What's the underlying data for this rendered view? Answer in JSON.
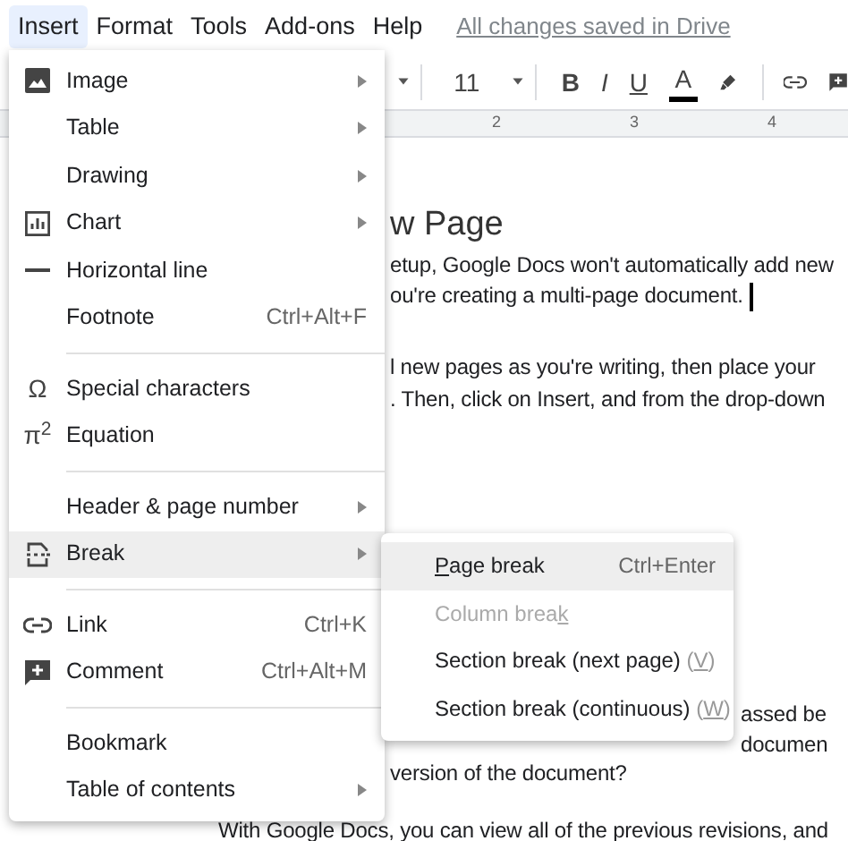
{
  "menubar": {
    "items": [
      {
        "label": "Insert",
        "selected": true
      },
      {
        "label": "Format",
        "selected": false
      },
      {
        "label": "Tools",
        "selected": false
      },
      {
        "label": "Add-ons",
        "selected": false
      },
      {
        "label": "Help",
        "selected": false
      }
    ],
    "save_status": "All changes saved in Drive"
  },
  "toolbar": {
    "font_size": "11",
    "format_buttons": [
      {
        "kind": "bold",
        "label": "B"
      },
      {
        "kind": "italic",
        "label": "I"
      },
      {
        "kind": "underline",
        "label": "U"
      },
      {
        "kind": "text_color",
        "label": "A"
      }
    ]
  },
  "ruler": {
    "numbers": [
      "2",
      "3",
      "4"
    ]
  },
  "document": {
    "blocks": [
      {
        "kind": "heading",
        "lines": [
          {
            "text": "w Page"
          }
        ]
      },
      {
        "kind": "paragraph",
        "lines": [
          {
            "text": "etup, Google Docs won't automatically add new"
          },
          {
            "text": "ou're creating a multi-page document.",
            "cursor": true
          }
        ]
      },
      {
        "kind": "paragraph",
        "lines": [
          {
            "text": "l new pages as you're writing, then place your"
          },
          {
            "text": ". Then, click on Insert, and from the drop-down"
          }
        ]
      },
      {
        "kind": "paragraph",
        "lines": [
          {
            "text": "assed be"
          },
          {
            "text": "documen"
          },
          {
            "text": "version of the document?"
          }
        ]
      },
      {
        "kind": "paragraph",
        "lines": [
          {
            "text": "With Google Docs, you can view all of the previous revisions, and"
          }
        ]
      }
    ]
  },
  "insert_menu": {
    "items": [
      {
        "kind": "item",
        "label": "Image",
        "submenu": true,
        "highlighted": false
      },
      {
        "kind": "item",
        "label": "Table",
        "submenu": true,
        "highlighted": false
      },
      {
        "kind": "item",
        "label": "Drawing",
        "submenu": true,
        "highlighted": false
      },
      {
        "kind": "item",
        "label": "Chart",
        "submenu": true,
        "highlighted": false
      },
      {
        "kind": "item",
        "label": "Horizontal line",
        "submenu": false,
        "highlighted": false
      },
      {
        "kind": "item",
        "label": "Footnote",
        "shortcut": "Ctrl+Alt+F",
        "submenu": false,
        "highlighted": false
      },
      {
        "kind": "separator"
      },
      {
        "kind": "item",
        "glyph": "Ω",
        "label": "Special characters",
        "submenu": false,
        "highlighted": false
      },
      {
        "kind": "item",
        "glyph": "π$^{2}$",
        "label": "Equation",
        "submenu": false,
        "highlighted": false
      },
      {
        "kind": "separator"
      },
      {
        "kind": "item",
        "label": "Header & page number",
        "submenu": true,
        "highlighted": false
      },
      {
        "kind": "item",
        "label": "Break",
        "submenu": true,
        "highlighted": true
      },
      {
        "kind": "separator"
      },
      {
        "kind": "item",
        "label": "Link",
        "shortcut": "Ctrl+K",
        "submenu": false,
        "highlighted": false
      },
      {
        "kind": "item",
        "label": "Comment",
        "shortcut": "Ctrl+Alt+M",
        "submenu": false,
        "highlighted": false
      },
      {
        "kind": "separator"
      },
      {
        "kind": "item",
        "label": "Bookmark",
        "submenu": false,
        "highlighted": false
      },
      {
        "kind": "item",
        "label": "Table of contents",
        "submenu": true,
        "highlighted": false
      }
    ]
  },
  "break_submenu": {
    "items": [
      {
        "mnemonic": "P",
        "after": "age break",
        "shortcut": "Ctrl+Enter",
        "highlighted": true,
        "disabled": false
      },
      {
        "before": "Column brea",
        "mnemonic": "k",
        "highlighted": false,
        "disabled": true
      },
      {
        "before": "Section break (next page) ",
        "hint": {
          "before": "(",
          "mnemonic": "V",
          "after": ")"
        },
        "highlighted": false,
        "disabled": false
      },
      {
        "before": "Section break (continuous) ",
        "hint": {
          "before": "(",
          "mnemonic": "W",
          "after": ")"
        },
        "highlighted": false,
        "disabled": false
      }
    ]
  }
}
